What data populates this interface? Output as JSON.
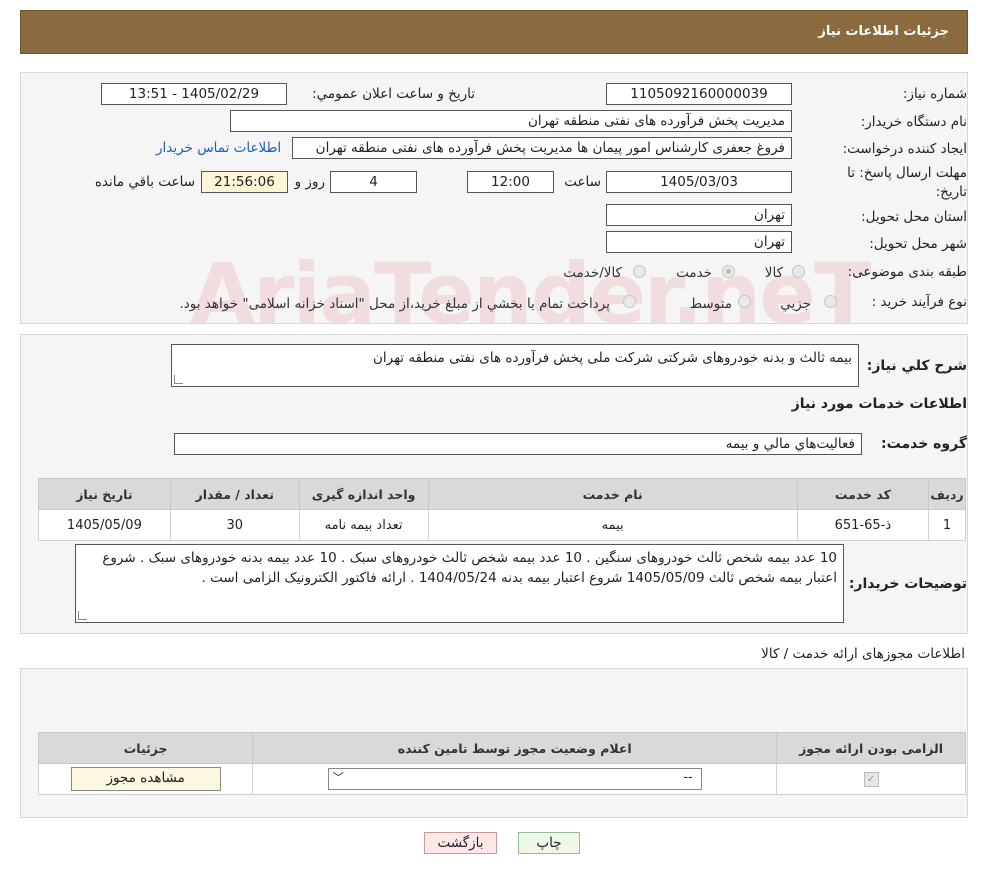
{
  "header": {
    "title": "جزئیات اطلاعات نیاز"
  },
  "labels": {
    "need_number": "شماره نیاز:",
    "announce_datetime": "تاریخ و ساعت اعلان عمومي:",
    "buyer_org": "نام دستگاه خريدار:",
    "requester": "ايجاد کننده درخواست:",
    "deadline_line1": "مهلت ارسال پاسخ: تا",
    "deadline_line2": "تاریخ:",
    "time": "ساعت",
    "days_and": "روز و",
    "remaining": "ساعت باقي مانده",
    "province": "استان محل تحويل:",
    "city": "شهر محل تحويل:",
    "category": "طبقه بندی موضوعی:",
    "purchase_type": "نوع فرآيند خريد :"
  },
  "values": {
    "need_number": "1105092160000039",
    "announce_datetime": "1405/02/29 - 13:51",
    "buyer_org": "مدیریت پخش فرآورده های نفتی منطقه تهران",
    "requester": "فروغ جعفری کارشناس امور پیمان ها مدیریت پخش فرآورده های نفتی منطقه تهران",
    "contact_link": "اطلاعات تماس خريدار",
    "deadline_date": "1405/03/03",
    "deadline_time": "12:00",
    "days": "4",
    "remaining_time": "21:56:06",
    "province": "تهران",
    "city": "تهران"
  },
  "category_options": [
    "کالا",
    "خدمت",
    "کالا/خدمت"
  ],
  "purchase_options": [
    "جزيي",
    "متوسط",
    "پرداخت تمام يا بخشي از مبلغ خريد،از محل \"اسناد خزانه اسلامی\" خواهد بود."
  ],
  "general": {
    "label": "شرح کلي نياز:",
    "text": "بیمه ثالث و بدنه خودروهای شرکتی شرکت ملی پخش فرآورده های نفتی منطقه تهران",
    "services_title": "اطلاعات خدمات مورد نياز",
    "group_label": "گروه خدمت:",
    "group_value": "فعاليت‌هاي مالي و بيمه"
  },
  "services_table": {
    "headers": [
      "رديف",
      "کد خدمت",
      "نام خدمت",
      "واحد اندازه گيری",
      "تعداد / مقدار",
      "تاريخ نياز"
    ],
    "rows": [
      [
        "1",
        "ذ-65-651",
        "بیمه",
        "تعداد بیمه نامه",
        "30",
        "1405/05/09"
      ]
    ]
  },
  "buyer_notes": {
    "label": "توضيحات خريدار:",
    "text": "10 عدد بیمه شخص ثالث خودروهای سنگین . 10 عدد بیمه شخص ثالث خودروهای سبک . 10 عدد بیمه بدنه خودروهای سبک . شروع اعتبار بیمه شخص ثالث 1405/05/09 شروع اعتبار بیمه بدنه 1404/05/24 . ارائه فاکتور الکترونیک الزامی است ."
  },
  "permits": {
    "title": "اطلاعات مجوزهای ارائه خدمت / کالا",
    "headers": [
      "الزامی بودن ارائه مجوز",
      "اعلام وضعيت مجوز توسط تامين کننده",
      "جزئيات"
    ],
    "select_value": "--",
    "view_button": "مشاهده مجوز"
  },
  "buttons": {
    "print": "چاپ",
    "back": "بازگشت"
  },
  "watermark": "AriaTender.neT",
  "colors": {
    "header_bg": "#8a6a3e",
    "link": "#1a5fb4",
    "back_button": "#fde8e8",
    "print_button": "#eef7e8"
  }
}
